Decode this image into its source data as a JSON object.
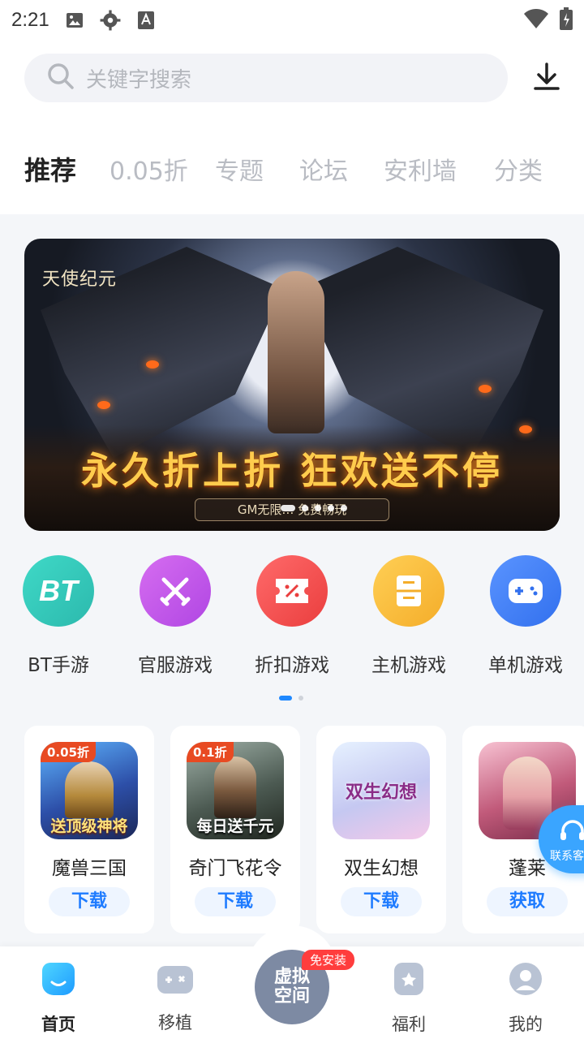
{
  "status_bar": {
    "time": "2:21"
  },
  "search": {
    "placeholder": "关键字搜索"
  },
  "tabs": [
    "推荐",
    "0.05折",
    "专题",
    "论坛",
    "安利墙",
    "分类"
  ],
  "banner": {
    "logo": "天使纪元",
    "slogan": "永久折上折 狂欢送不停",
    "subline": "GM无限… 免费畅玩"
  },
  "categories": [
    {
      "label": "BT手游",
      "icon": "bt-icon",
      "color": "#33c7b8",
      "glyph": "BT"
    },
    {
      "label": "官服游戏",
      "icon": "crossed-swords-icon",
      "color": "#c558ea"
    },
    {
      "label": "折扣游戏",
      "icon": "discount-ticket-icon",
      "color": "#f24f4f"
    },
    {
      "label": "主机游戏",
      "icon": "console-icon",
      "color": "#f7bd3c"
    },
    {
      "label": "单机游戏",
      "icon": "gamepad-icon",
      "color": "#3f80f5"
    }
  ],
  "games": [
    {
      "name": "魔兽三国",
      "action": "下载",
      "badge": "0.05折",
      "art_caption": "送顶级神将"
    },
    {
      "name": "奇门飞花令",
      "action": "下载",
      "badge": "0.1折",
      "art_caption": "每日送千元"
    },
    {
      "name": "双生幻想",
      "action": "下载",
      "art_caption": "双生幻想"
    },
    {
      "name": "蓬莱",
      "action": "获取"
    }
  ],
  "service": {
    "label": "联系客"
  },
  "bottom_nav": {
    "items": [
      {
        "label": "首页",
        "icon": "home-icon",
        "active": true
      },
      {
        "label": "移植",
        "icon": "port-gamepad-icon"
      },
      {
        "label": "福利",
        "icon": "gift-card-icon"
      },
      {
        "label": "我的",
        "icon": "profile-icon"
      }
    ],
    "center": {
      "label": "虚拟空间",
      "tag": "免安装"
    }
  },
  "colors": {
    "accent": "#1e7bff",
    "pager_active": "#1e88ff"
  }
}
